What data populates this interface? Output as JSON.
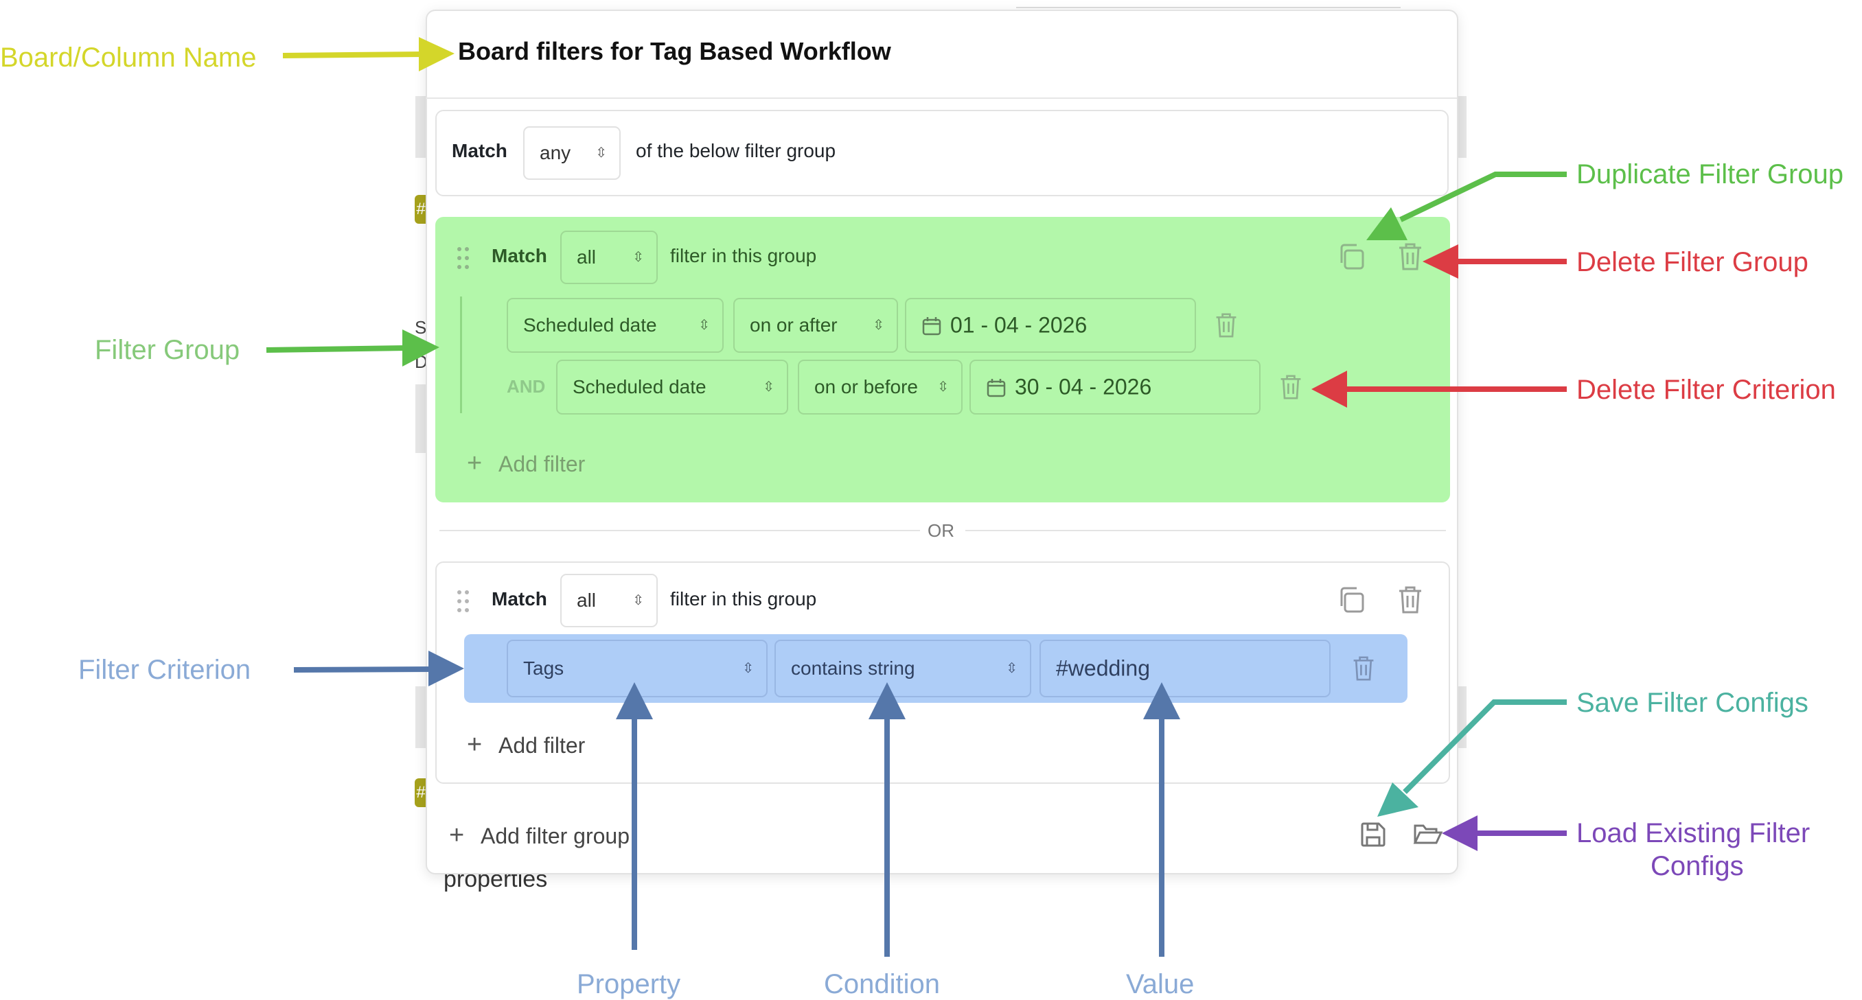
{
  "dialog": {
    "title": "Board filters for Tag Based Workflow",
    "top_match": {
      "label": "Match",
      "value": "any",
      "suffix": "of the below filter group"
    },
    "groups": [
      {
        "match_label": "Match",
        "match_value": "all",
        "suffix": "filter in this group",
        "criteria": [
          {
            "connector": "",
            "property": "Scheduled date",
            "condition": "on or after",
            "value": "01 - 04 - 2026"
          },
          {
            "connector": "AND",
            "property": "Scheduled date",
            "condition": "on or before",
            "value": "30 - 04 - 2026"
          }
        ],
        "add_filter": "Add filter"
      },
      {
        "match_label": "Match",
        "match_value": "all",
        "suffix": "filter in this group",
        "criteria": [
          {
            "property": "Tags",
            "condition": "contains string",
            "value": "#wedding"
          }
        ],
        "add_filter": "Add filter"
      }
    ],
    "or_label": "OR",
    "add_filter_group": "Add filter group"
  },
  "background": {
    "text_bottom": "properties",
    "side_letters": [
      "S",
      "D"
    ],
    "badge": "#"
  },
  "annotations": {
    "board_column_name": "Board/Column Name",
    "filter_group": "Filter Group",
    "filter_criterion": "Filter Criterion",
    "duplicate_filter_group": "Duplicate Filter Group",
    "delete_filter_group": "Delete Filter Group",
    "delete_filter_criterion": "Delete Filter Criterion",
    "save_filter_configs": "Save Filter Configs",
    "load_existing_filter_configs_line1": "Load Existing Filter",
    "load_existing_filter_configs_line2": "Configs",
    "property": "Property",
    "condition": "Condition",
    "value": "Value"
  },
  "colors": {
    "yellow": "#d4d62a",
    "green": "#5cbf4a",
    "light_green_text": "#86c97a",
    "red": "#dc3c44",
    "blue": "#5577aa",
    "light_blue_text": "#8aaad6",
    "teal": "#4bb2a0",
    "purple": "#7c48b8",
    "group_highlight": "#b3f7aa",
    "criterion_highlight": "#aecdf7"
  },
  "icons": {
    "drag": "drag-handle-icon",
    "duplicate": "duplicate-icon",
    "trash": "trash-icon",
    "calendar": "calendar-icon",
    "plus": "plus-icon",
    "save": "save-icon",
    "folder": "folder-open-icon"
  }
}
